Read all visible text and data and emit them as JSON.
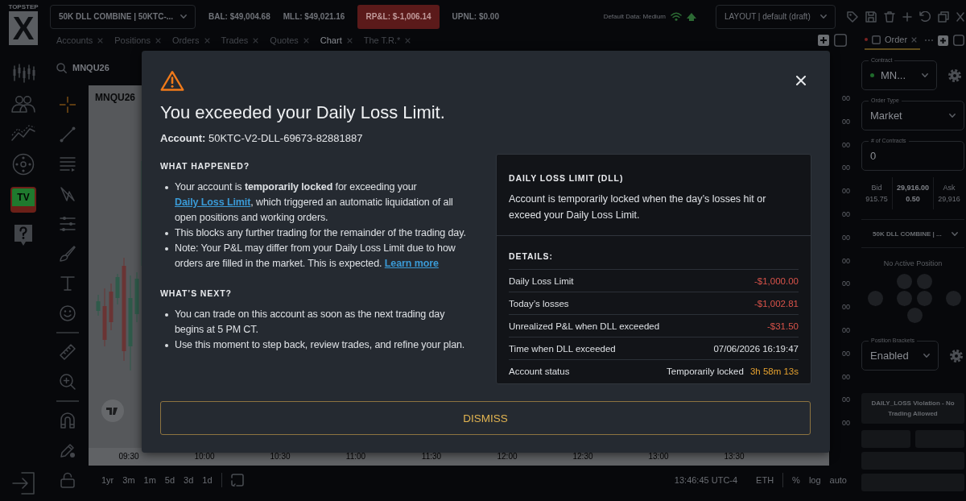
{
  "header": {
    "logo": {
      "wordmark": "TOPSTEP",
      "letter": "X"
    },
    "account_select": "50K DLL COMBINE | 50KTC-...",
    "stats": [
      {
        "text": "BAL: $49,004.68",
        "kind": "plain"
      },
      {
        "text": "MLL: $49,021.16",
        "kind": "plain"
      },
      {
        "text": "RP&L: $-1,006.14",
        "kind": "alert"
      },
      {
        "text": "UPNL: $0.00",
        "kind": "plain"
      }
    ],
    "connection": "Default Data: Medium",
    "layout_select": "LAYOUT | default (draft)"
  },
  "tabs": [
    {
      "label": "Accounts",
      "selected": false
    },
    {
      "label": "Positions",
      "selected": false
    },
    {
      "label": "Orders",
      "selected": false
    },
    {
      "label": "Trades",
      "selected": false
    },
    {
      "label": "Quotes",
      "selected": false
    },
    {
      "label": "Chart",
      "selected": true
    },
    {
      "label": "The T.R.*",
      "selected": false
    }
  ],
  "sidebar": {
    "tv_badge": "TV"
  },
  "chart_panel": {
    "symbol": "MNQU26",
    "chart_title": "MNQU26",
    "price_labels": [
      "00",
      "00",
      "00",
      "00",
      "00",
      "00",
      "00",
      "00",
      "00",
      "00",
      "00",
      "00",
      "00",
      "00",
      "00"
    ],
    "time_labels": [
      "09:30",
      "10:00",
      "10:30",
      "11:00",
      "11:30",
      "12:00",
      "12:30",
      "13:00",
      "13:30"
    ],
    "ranges": [
      "1yr",
      "3m",
      "1m",
      "5d",
      "3d",
      "1d"
    ],
    "clock": "13:46:45 UTC-4",
    "session": "ETH",
    "scale_options": [
      "%",
      "log",
      "auto"
    ]
  },
  "order_panel": {
    "tab": "Order",
    "contract": {
      "label": "Contract",
      "value": "MN..."
    },
    "order_type": {
      "label": "Order Type",
      "value": "Market"
    },
    "quantity": {
      "label": "# of Contracts",
      "value": "0"
    },
    "quotes": [
      {
        "label": "Bid",
        "value": "915.75"
      },
      {
        "label": "29,916.00",
        "value": "0.50"
      },
      {
        "label": "Ask",
        "value": "29,916"
      }
    ],
    "account_select": "50K DLL COMBINE | ...",
    "position_status": "No Active Position",
    "brackets": {
      "label": "Position Brackets",
      "value": "Enabled"
    },
    "violation": "DAILY_LOSS Violation - No Trading Allowed"
  },
  "modal": {
    "title": "You exceeded your Daily Loss Limit.",
    "account": "**Account:** 50KTC-V2-DLL-69673-82881887",
    "sections": [
      {
        "heading": "WHAT HAPPENED?",
        "items": [
          [
            {
              "kind": "text",
              "text": "Your account is **temporarily locked** for exceeding your "
            },
            {
              "kind": "link",
              "text": "Daily Loss Limit"
            },
            {
              "kind": "text",
              "text": ", which triggered an automatic liquidation of all open positions and working orders."
            }
          ],
          [
            {
              "kind": "text",
              "text": "This blocks any further trading for the remainder of the trading day."
            }
          ],
          [
            {
              "kind": "text",
              "text": "Note: Your P&L may differ from your Daily Loss Limit due to how orders are filled in the market. This is expected. "
            },
            {
              "kind": "link",
              "text": "Learn more"
            }
          ]
        ]
      },
      {
        "heading": "WHAT’S NEXT?",
        "items": [
          [
            {
              "kind": "text",
              "text": "You can trade on this account as soon as the next trading day begins at 5 PM CT."
            }
          ],
          [
            {
              "kind": "text",
              "text": "Use this moment to step back, review trades, and refine your plan."
            }
          ]
        ]
      }
    ],
    "card": {
      "title": "DAILY LOSS LIMIT (DLL)",
      "description": "Account is temporarily locked when the day’s losses hit or exceed your Daily Loss Limit.",
      "details_heading": "DETAILS:",
      "rows": [
        {
          "kind": "loss",
          "label": "Daily Loss Limit",
          "value": "-$1,000.00"
        },
        {
          "kind": "loss",
          "label": "Today’s losses",
          "value": "-$1,002.81"
        },
        {
          "kind": "loss",
          "label": "Unrealized P&L when DLL exceeded",
          "value": "-$31.50"
        },
        {
          "kind": "plain",
          "label": "Time when DLL exceeded",
          "value": "07/06/2026 16:19:47"
        },
        {
          "kind": "status",
          "label": "Account status",
          "value": "Temporarily locked",
          "timer": "3h 58m 13s"
        }
      ]
    },
    "dismiss": "DISMISS"
  }
}
